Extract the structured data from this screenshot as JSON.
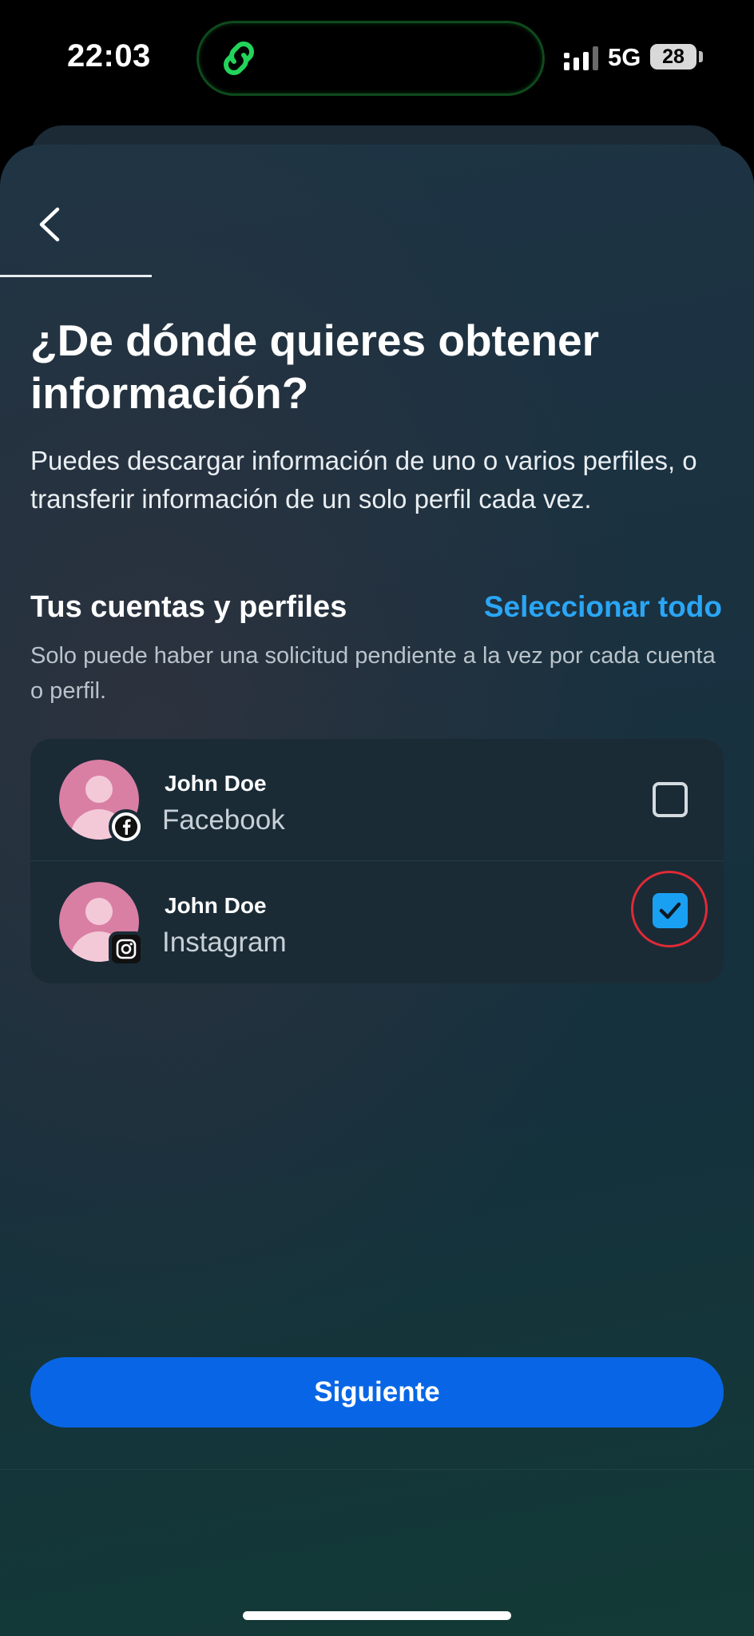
{
  "status_bar": {
    "time": "22:03",
    "network": "5G",
    "battery": "28",
    "island_icon": "link-chain-icon",
    "signal_icon": "signal-bars-icon"
  },
  "nav": {
    "back_icon": "chevron-left-icon"
  },
  "page": {
    "title": "¿De dónde quieres obtener información?",
    "subtitle": "Puedes descargar información de uno o varios perfiles, o transferir información de un solo perfil cada vez."
  },
  "section": {
    "title": "Tus cuentas y perfiles",
    "select_all": "Seleccionar todo",
    "note": "Solo puede haber una solicitud pendiente a la vez por cada cuenta o perfil."
  },
  "accounts": [
    {
      "name": "John Doe",
      "platform": "Facebook",
      "badge_icon": "facebook-icon",
      "checked": false
    },
    {
      "name": "John Doe",
      "platform": "Instagram",
      "badge_icon": "instagram-icon",
      "checked": true
    }
  ],
  "footer": {
    "next_label": "Siguiente"
  },
  "colors": {
    "accent": "#0866e6",
    "link": "#2aa6f5",
    "checkbox_checked": "#1aa0f2",
    "highlight_ring": "#e02a36",
    "avatar": "#d97fa4"
  }
}
